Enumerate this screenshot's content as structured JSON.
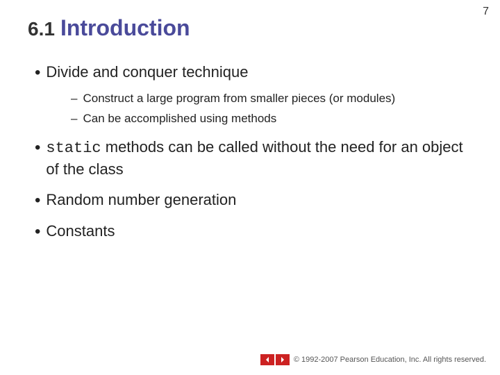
{
  "page": {
    "number": "7",
    "background": "#ffffff"
  },
  "title": {
    "number": "6.1",
    "text": "Introduction"
  },
  "bullets": [
    {
      "id": "bullet-1",
      "text": "Divide and conquer technique",
      "sub_bullets": [
        "Construct a large program from smaller pieces (or modules)",
        "Can be accomplished using methods"
      ]
    },
    {
      "id": "bullet-2",
      "prefix": "",
      "mono": "static",
      "text": " methods can be called without the need for an object of the class"
    },
    {
      "id": "bullet-3",
      "text": "Random number generation"
    },
    {
      "id": "bullet-4",
      "text": "Constants"
    }
  ],
  "footer": {
    "copyright": "© 1992-2007 Pearson Education, Inc.  All rights reserved."
  }
}
